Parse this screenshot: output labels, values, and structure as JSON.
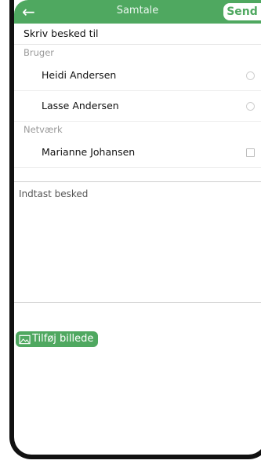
{
  "header": {
    "back_icon": "arrow-left-icon",
    "title": "Samtale",
    "send_label": "Send"
  },
  "recipient": {
    "label": "Skriv besked til"
  },
  "groups": [
    {
      "label": "Bruger",
      "items": [
        {
          "name": "Heidi Andersen",
          "control": "radio"
        },
        {
          "name": "Lasse Andersen",
          "control": "radio"
        }
      ]
    },
    {
      "label": "Netværk",
      "items": [
        {
          "name": "Marianne Johansen",
          "control": "checkbox"
        }
      ]
    }
  ],
  "message": {
    "placeholder": "Indtast besked"
  },
  "add_image": {
    "icon": "image-icon",
    "label": "Tilføj billede"
  },
  "colors": {
    "accent": "#4fa860",
    "text": "#111111",
    "muted": "#9a9a9a"
  }
}
